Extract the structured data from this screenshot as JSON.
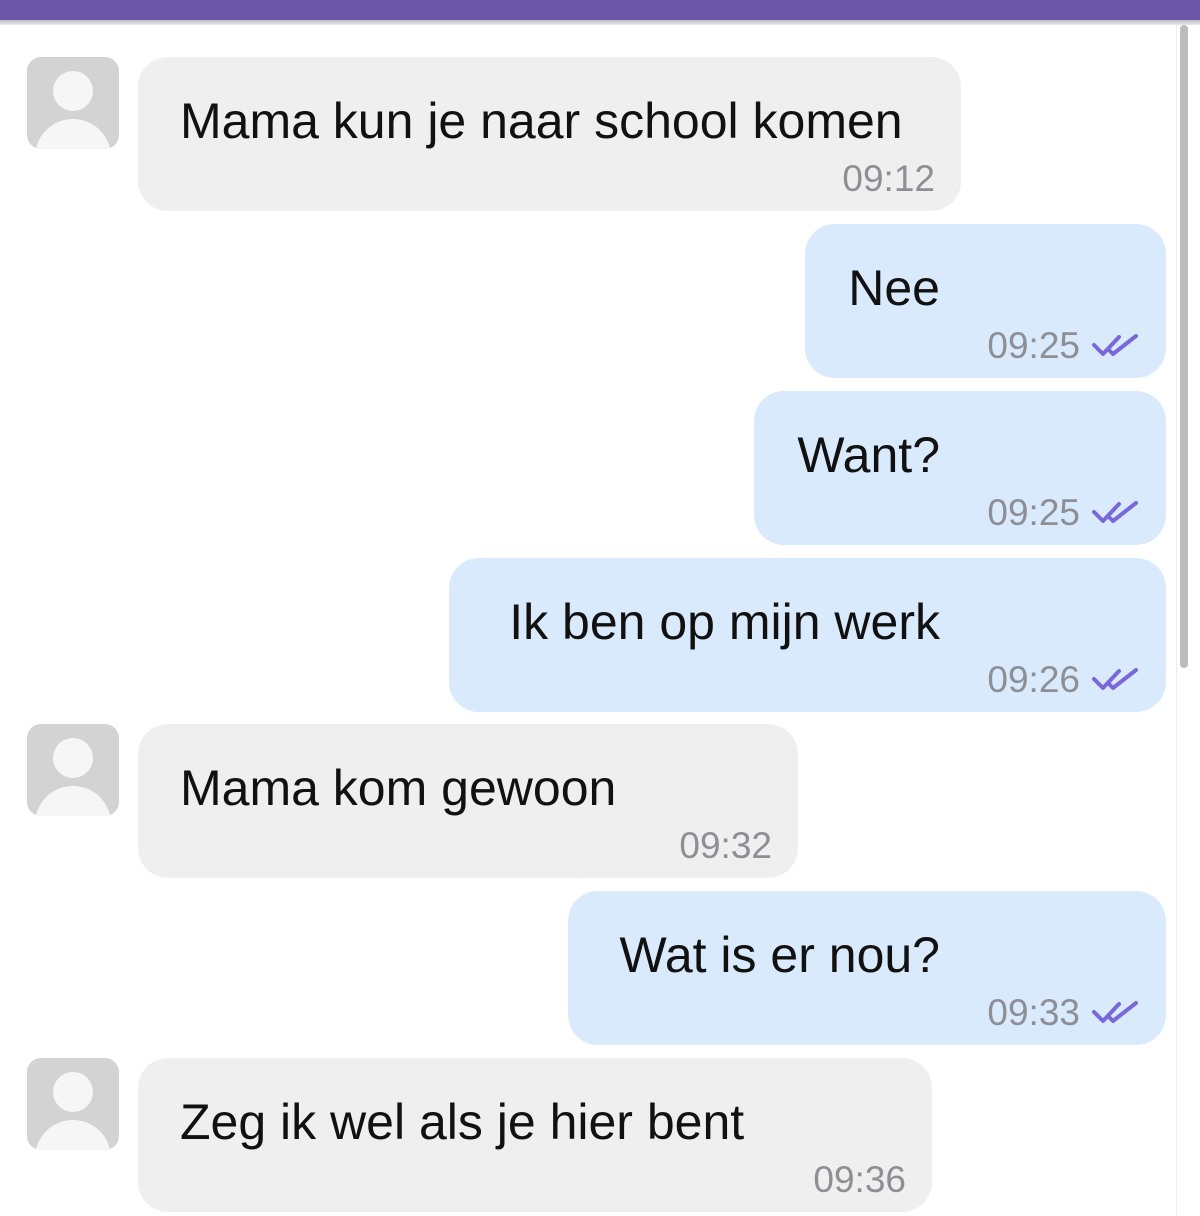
{
  "colors": {
    "accent": "#6a57a9",
    "incoming_bubble": "#efefef",
    "outgoing_bubble": "#d9eafc",
    "read_tick": "#7a67d8",
    "timestamp": "#8d8f95"
  },
  "messages": [
    {
      "direction": "incoming",
      "text": "Mama kun je naar school komen",
      "time": "09:12",
      "avatar_icon": "user-avatar-icon"
    },
    {
      "direction": "outgoing",
      "text": "Nee",
      "time": "09:25",
      "status_icon": "double-check-icon"
    },
    {
      "direction": "outgoing",
      "text": "Want?",
      "time": "09:25",
      "status_icon": "double-check-icon"
    },
    {
      "direction": "outgoing",
      "text": "Ik ben op mijn werk",
      "time": "09:26",
      "status_icon": "double-check-icon"
    },
    {
      "direction": "incoming",
      "text": "Mama kom gewoon",
      "time": "09:32",
      "avatar_icon": "user-avatar-icon"
    },
    {
      "direction": "outgoing",
      "text": "Wat is er nou?",
      "time": "09:33",
      "status_icon": "double-check-icon"
    },
    {
      "direction": "incoming",
      "text": "Zeg ik wel als je hier bent",
      "time": "09:36",
      "avatar_icon": "user-avatar-icon"
    }
  ]
}
